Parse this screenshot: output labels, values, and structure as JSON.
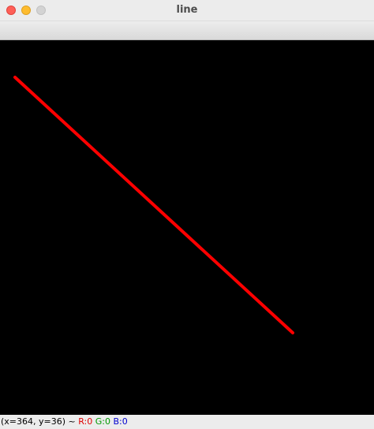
{
  "window": {
    "title": "line"
  },
  "canvas": {
    "background": "#000000",
    "line_color": "#ff0000"
  },
  "status": {
    "coords": "(x=364, y=36) ~",
    "r": "R:0",
    "g": "G:0",
    "b": "B:0"
  },
  "colors": {
    "close": "#fe5f57",
    "minimize": "#febc2e",
    "zoom": "#d3d3d3"
  }
}
